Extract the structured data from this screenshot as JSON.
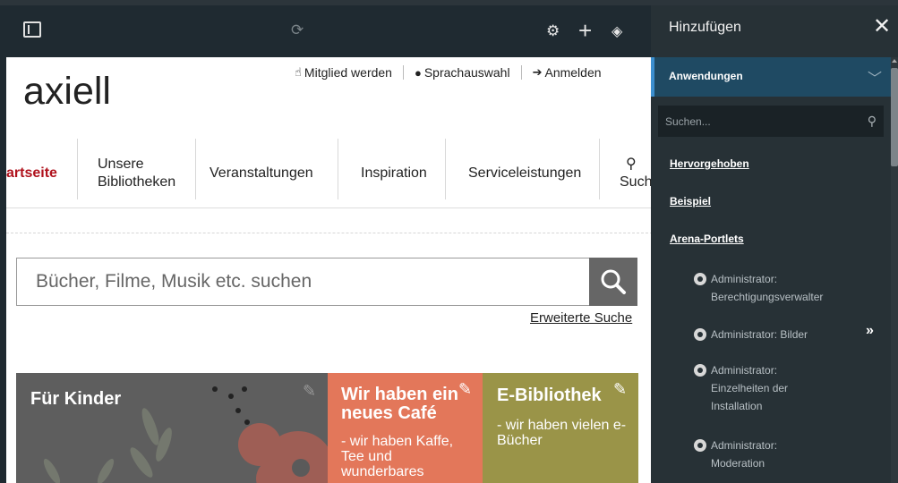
{
  "site": {
    "logo": "axiell",
    "top_links": [
      {
        "label": "Mitglied werden",
        "icon": "thumbs-up-icon"
      },
      {
        "label": "Sprachauswahl",
        "icon": "globe-icon"
      },
      {
        "label": "Anmelden",
        "icon": "sign-in-icon"
      }
    ],
    "nav": {
      "home": "artseite",
      "libraries": "Unsere Bibliotheken",
      "events": "Veranstaltungen",
      "inspiration": "Inspiration",
      "services": "Serviceleistungen",
      "search": "Such"
    },
    "search": {
      "placeholder": "Bücher, Filme, Musik etc. suchen",
      "advanced": "Erweiterte Suche"
    },
    "tiles": [
      {
        "title": "Für Kinder",
        "subtitle": "",
        "color": "#6b6b6b"
      },
      {
        "title": "Wir haben ein neues Café",
        "subtitle": "- wir haben Kaffe, Tee und wunderbares",
        "color": "#e3775a"
      },
      {
        "title": "E-Bibliothek",
        "subtitle": "- wir haben vielen e-Bücher",
        "color": "#9a9448"
      }
    ]
  },
  "panel": {
    "title": "Hinzufügen",
    "accordion": "Anwendungen",
    "search_placeholder": "Suchen...",
    "categories": [
      "Hervorgehoben",
      "Beispiel",
      "Arena-Portlets"
    ],
    "portlets": [
      "Administrator: Berechtigungsverwalter",
      "Administrator: Bilder",
      "Administrator: Einzelheiten der Installation",
      "Administrator: Moderation"
    ]
  },
  "colors": {
    "toolbar": "#1f2a31",
    "panel": "#273136",
    "accent": "#3c8fcf",
    "home_nav": "#b0121d"
  }
}
